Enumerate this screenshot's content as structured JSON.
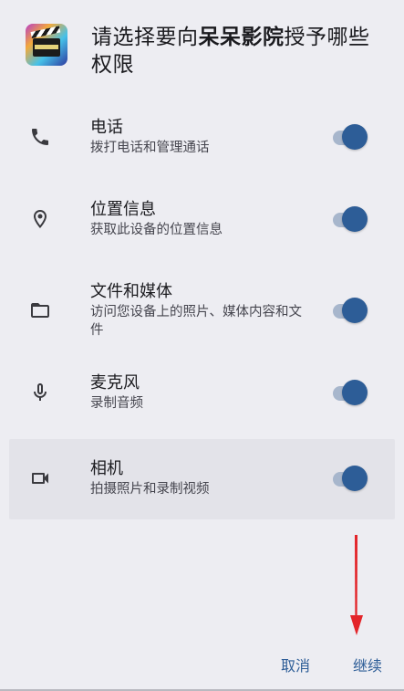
{
  "header": {
    "app_icon": "clapperboard-app-icon",
    "title_prefix": "请选择要向",
    "app_name": "呆呆影院",
    "title_suffix": "授予哪些权限"
  },
  "permissions": [
    {
      "title": "电话",
      "subtitle": "拨打电话和管理通话",
      "icon": "phone-icon",
      "enabled": true
    },
    {
      "title": "位置信息",
      "subtitle": "获取此设备的位置信息",
      "icon": "location-pin-icon",
      "enabled": true
    },
    {
      "title": "文件和媒体",
      "subtitle": "访问您设备上的照片、媒体内容和文件",
      "icon": "folder-icon",
      "enabled": true
    },
    {
      "title": "麦克风",
      "subtitle": "录制音频",
      "icon": "microphone-icon",
      "enabled": true
    },
    {
      "title": "相机",
      "subtitle": "拍摄照片和录制视频",
      "icon": "video-camera-icon",
      "enabled": true
    }
  ],
  "footer": {
    "cancel_label": "取消",
    "continue_label": "继续"
  },
  "colors": {
    "accent": "#2d5d97",
    "toggle_track": "#a7b6cc",
    "background": "#ededf2",
    "annotation_arrow": "#e3252a"
  }
}
